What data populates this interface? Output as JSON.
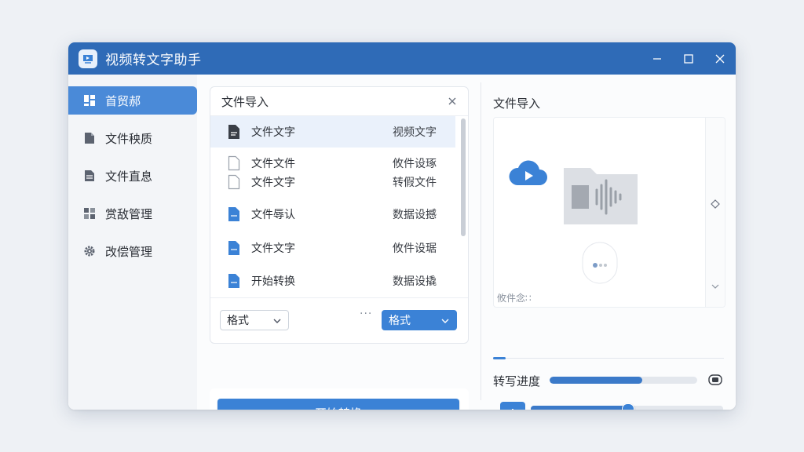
{
  "app": {
    "title": "视频转文字助手"
  },
  "sidebar": {
    "items": [
      {
        "label": "首贸郝",
        "icon": "dashboard-icon",
        "active": true
      },
      {
        "label": "文件秧质",
        "icon": "file-icon",
        "active": false
      },
      {
        "label": "文件直息",
        "icon": "document-icon",
        "active": false
      },
      {
        "label": "赏敌管理",
        "icon": "grid-icon",
        "active": false
      },
      {
        "label": "改偿管理",
        "icon": "gear-icon",
        "active": false
      }
    ]
  },
  "file_panel": {
    "title": "文件导入",
    "files": [
      {
        "name": "文件文字",
        "tag": "视频文字",
        "icon": "file-dark-icon",
        "selected": true
      },
      {
        "name": "文件文件",
        "tag": "攸件设琢",
        "icon": "file-outline-icon",
        "selected": false
      },
      {
        "name": "文件文字",
        "tag": "转假文件",
        "icon": "file-outline-icon",
        "selected": false
      },
      {
        "name": "文件辱认",
        "tag": "数据设撼",
        "icon": "file-blue-icon",
        "selected": false
      },
      {
        "name": "文件文字",
        "tag": "攸件设琚",
        "icon": "file-blue-icon",
        "selected": false
      },
      {
        "name": "开始转换",
        "tag": "数据设撬",
        "icon": "file-blue-icon",
        "selected": false
      }
    ],
    "format_left": "格式",
    "more": "···",
    "format_right": "格式"
  },
  "start_button": "开始转换",
  "preview": {
    "title": "文件导入",
    "caption": "攸件念∷"
  },
  "progress": {
    "label": "转写进度",
    "value": 0.63
  },
  "slider": {
    "value": 0.5
  },
  "add_label": "+",
  "colors": {
    "titlebar": "#2f6bb7",
    "accent": "#3b82d6",
    "active_nav": "#4a8ad8"
  }
}
